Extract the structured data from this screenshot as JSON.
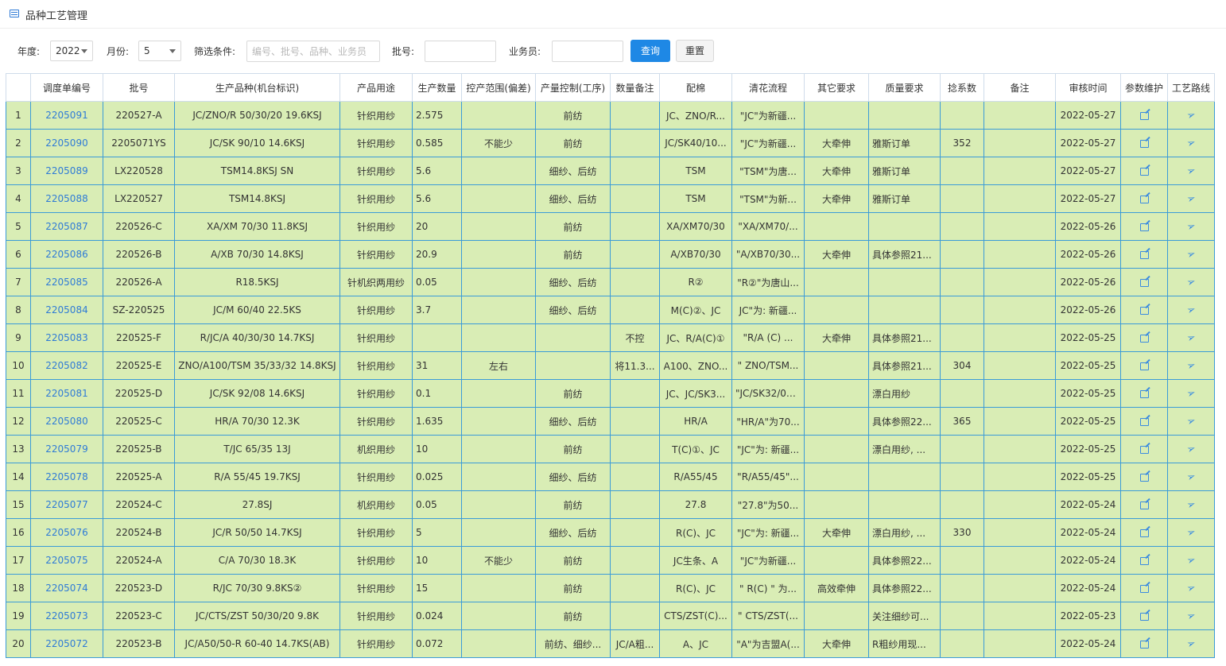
{
  "title": "品种工艺管理",
  "filters": {
    "year_label": "年度:",
    "year_value": "2022",
    "month_label": "月份:",
    "month_value": "5",
    "cond_label": "筛选条件:",
    "cond_placeholder": "编号、批号、品种、业务员",
    "batch_label": "批号:",
    "batch_value": "",
    "sales_label": "业务员:",
    "sales_value": "",
    "query_button": "查询",
    "reset_button": "重置"
  },
  "table": {
    "columns": [
      "",
      "调度单编号",
      "批号",
      "生产品种(机台标识)",
      "产品用途",
      "生产数量",
      "控产范围(偏差)",
      "产量控制(工序)",
      "数量备注",
      "配棉",
      "清花流程",
      "其它要求",
      "质量要求",
      "捻系数",
      "备注",
      "审核时间",
      "参数维护",
      "工艺路线"
    ],
    "rows": [
      [
        "1",
        "2205091",
        "220527-A",
        "JC/ZNO/R 50/30/20 19.6KSJ",
        "针织用纱",
        "2.575",
        "",
        "前纺",
        "",
        "JC、ZNO/R...",
        "\"JC\"为新疆...",
        "",
        "",
        "",
        "",
        "2022-05-27"
      ],
      [
        "2",
        "2205090",
        "2205071YS",
        "JC/SK 90/10 14.6KSJ",
        "针织用纱",
        "0.585",
        "不能少",
        "前纺",
        "",
        "JC/SK40/10...",
        "\"JC\"为新疆...",
        "大牵伸",
        "雅斯订单",
        "352",
        "",
        "2022-05-27"
      ],
      [
        "3",
        "2205089",
        "LX220528",
        "TSM14.8KSJ SN",
        "针织用纱",
        "5.6",
        "",
        "细纱、后纺",
        "",
        "TSM",
        "\"TSM\"为唐...",
        "大牵伸",
        "雅斯订单",
        "",
        "",
        "2022-05-27"
      ],
      [
        "4",
        "2205088",
        "LX220527",
        "TSM14.8KSJ",
        "针织用纱",
        "5.6",
        "",
        "细纱、后纺",
        "",
        "TSM",
        "\"TSM\"为新...",
        "大牵伸",
        "雅斯订单",
        "",
        "",
        "2022-05-27"
      ],
      [
        "5",
        "2205087",
        "220526-C",
        "XA/XM 70/30 11.8KSJ",
        "针织用纱",
        "20",
        "",
        "前纺",
        "",
        "XA/XM70/30",
        "\"XA/XM70/...",
        "",
        "",
        "",
        "",
        "2022-05-26"
      ],
      [
        "6",
        "2205086",
        "220526-B",
        "A/XB 70/30 14.8KSJ",
        "针织用纱",
        "20.9",
        "",
        "前纺",
        "",
        "A/XB70/30",
        "\"A/XB70/30...",
        "大牵伸",
        "具体参照21...",
        "",
        "",
        "2022-05-26"
      ],
      [
        "7",
        "2205085",
        "220526-A",
        "R18.5KSJ",
        "针机织两用纱",
        "0.05",
        "",
        "细纱、后纺",
        "",
        "R②",
        "\"R②\"为唐山...",
        "",
        "",
        "",
        "",
        "2022-05-26"
      ],
      [
        "8",
        "2205084",
        "SZ-220525",
        "JC/M 60/40 22.5KS",
        "针织用纱",
        "3.7",
        "",
        "细纱、后纺",
        "",
        "M(C)②、JC",
        "JC\"为: 新疆...",
        "",
        "",
        "",
        "",
        "2022-05-26"
      ],
      [
        "9",
        "2205083",
        "220525-F",
        "R/JC/A 40/30/30 14.7KSJ",
        "针织用纱",
        "",
        "",
        "",
        "不控",
        "JC、R/A(C)①",
        "\"R/A (C) ...",
        "大牵伸",
        "具体参照21...",
        "",
        "",
        "2022-05-25"
      ],
      [
        "10",
        "2205082",
        "220525-E",
        "ZNO/A100/TSM 35/33/32 14.8KSJ",
        "针织用纱",
        "31",
        "左右",
        "",
        "将11.3...",
        "A100、ZNO...",
        "\" ZNO/TSM...",
        "",
        "具体参照21...",
        "304",
        "",
        "2022-05-25"
      ],
      [
        "11",
        "2205081",
        "220525-D",
        "JC/SK 92/08 14.6KSJ",
        "针织用纱",
        "0.1",
        "",
        "前纺",
        "",
        "JC、JC/SK3...",
        "\"JC/SK32/08...",
        "",
        "漂白用纱",
        "",
        "",
        "2022-05-25"
      ],
      [
        "12",
        "2205080",
        "220525-C",
        "HR/A 70/30 12.3K",
        "针织用纱",
        "1.635",
        "",
        "细纱、后纺",
        "",
        "HR/A",
        "\"HR/A\"为70...",
        "",
        "具体参照22...",
        "365",
        "",
        "2022-05-25"
      ],
      [
        "13",
        "2205079",
        "220525-B",
        "T/JC 65/35 13J",
        "机织用纱",
        "10",
        "",
        "前纺",
        "",
        "T(C)①、JC",
        "\"JC\"为: 新疆...",
        "",
        "漂白用纱, ...",
        "",
        "",
        "2022-05-25"
      ],
      [
        "14",
        "2205078",
        "220525-A",
        "R/A 55/45 19.7KSJ",
        "针织用纱",
        "0.025",
        "",
        "细纱、后纺",
        "",
        "R/A55/45",
        "\"R/A55/45\"...",
        "",
        "",
        "",
        "",
        "2022-05-25"
      ],
      [
        "15",
        "2205077",
        "220524-C",
        "27.8SJ",
        "机织用纱",
        "0.05",
        "",
        "前纺",
        "",
        "27.8",
        "\"27.8\"为50...",
        "",
        "",
        "",
        "",
        "2022-05-24"
      ],
      [
        "16",
        "2205076",
        "220524-B",
        "JC/R 50/50 14.7KSJ",
        "针织用纱",
        "5",
        "",
        "细纱、后纺",
        "",
        "R(C)、JC",
        "\"JC\"为: 新疆...",
        "大牵伸",
        "漂白用纱, ...",
        "330",
        "",
        "2022-05-24"
      ],
      [
        "17",
        "2205075",
        "220524-A",
        "C/A 70/30 18.3K",
        "针织用纱",
        "10",
        "不能少",
        "前纺",
        "",
        "JC生条、A",
        "\"JC\"为新疆...",
        "",
        "具体参照22...",
        "",
        "",
        "2022-05-24"
      ],
      [
        "18",
        "2205074",
        "220523-D",
        "R/JC 70/30 9.8KS②",
        "针织用纱",
        "15",
        "",
        "前纺",
        "",
        "R(C)、JC",
        "\" R(C) \" 为...",
        "高效牵伸",
        "具体参照22...",
        "",
        "",
        "2022-05-24"
      ],
      [
        "19",
        "2205073",
        "220523-C",
        "JC/CTS/ZST 50/30/20 9.8K",
        "针织用纱",
        "0.024",
        "",
        "前纺",
        "",
        "CTS/ZST(C)...",
        "\" CTS/ZST(...",
        "",
        "关注细纱可...",
        "",
        "",
        "2022-05-23"
      ],
      [
        "20",
        "2205072",
        "220523-B",
        "JC/A50/50-R 60-40 14.7KS(AB)",
        "针织用纱",
        "0.072",
        "",
        "前纺、细纱...",
        "JC/A粗...",
        "A、JC",
        "\"A\"为吉盟A(...",
        "大牵伸",
        "R粗纱用现...",
        "",
        "",
        "2022-05-24"
      ]
    ]
  },
  "icons": {
    "edit": "edit-icon",
    "route": "send-icon"
  },
  "colors": {
    "row_bg": "#d9edb5",
    "cell_border": "#3a9bd8",
    "link": "#2f7bd6",
    "primary_button": "#1e88e5"
  }
}
